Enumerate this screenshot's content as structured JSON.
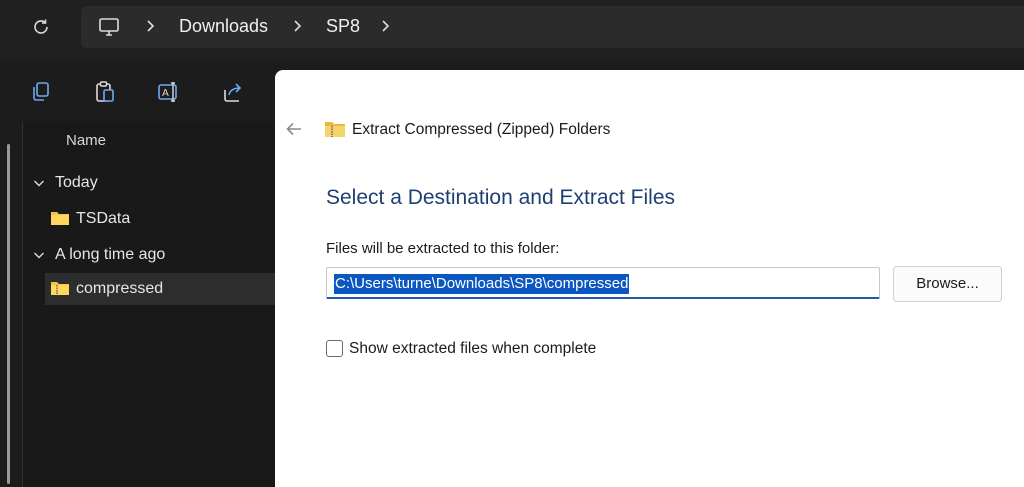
{
  "address_bar": {
    "crumbs": [
      "Downloads",
      "SP8"
    ]
  },
  "file_list": {
    "column_name": "Name",
    "groups": [
      {
        "label": "Today",
        "items": [
          "TSData"
        ]
      },
      {
        "label": "A long time ago",
        "items": [
          "compressed"
        ]
      }
    ]
  },
  "dialog": {
    "title": "Extract Compressed (Zipped) Folders",
    "heading": "Select a Destination and Extract Files",
    "destination_label": "Files will be extracted to this folder:",
    "destination_value": "C:\\Users\\turne\\Downloads\\SP8\\compressed",
    "browse_label": "Browse...",
    "show_files_label": "Show extracted files when complete",
    "show_files_checked": false
  },
  "colors": {
    "heading": "#1e3f72",
    "selection": "#0a57c2",
    "folder": "#f4c542"
  },
  "icons": [
    "refresh-icon",
    "this-pc-icon",
    "chevron-right-icon",
    "copy-icon",
    "paste-icon",
    "rename-icon",
    "share-icon",
    "chevron-down-icon",
    "folder-icon",
    "zip-folder-icon",
    "back-arrow-icon"
  ]
}
